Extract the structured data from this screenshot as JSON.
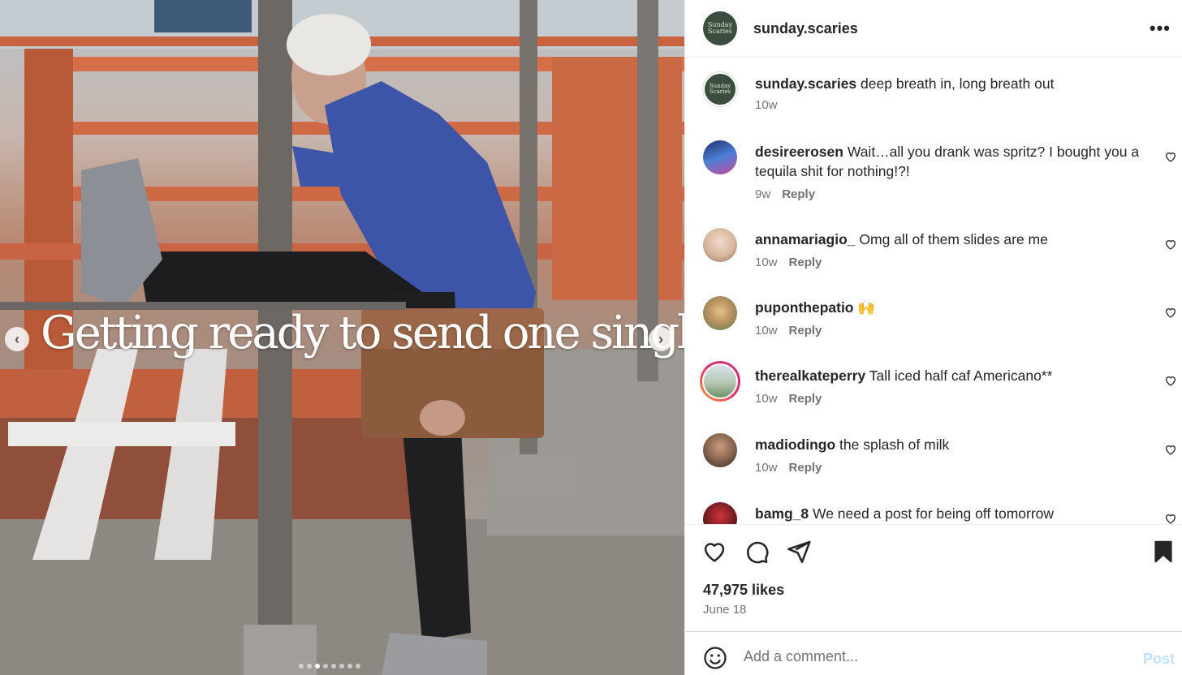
{
  "post": {
    "username": "sunday.scaries",
    "brand_avatar_text": [
      "Sunday",
      "Scaries"
    ],
    "media": {
      "overlay_text": "Getting ready to send one single email",
      "prev_icon": "chevron-left-icon",
      "next_icon": "chevron-right-icon",
      "slide_count": 8,
      "active_slide": 3
    },
    "caption": {
      "username": "sunday.scaries",
      "text": "deep breath in, long breath out",
      "time": "10w"
    },
    "comments": [
      {
        "username": "desireerosen",
        "text": "Wait…all you drank was spritz? I bought you a tequila shit for nothing!?!",
        "time": "9w",
        "reply": "Reply",
        "avatar_color": "#2e4b8f"
      },
      {
        "username": "annamariagio_",
        "text": "Omg all of them slides are me",
        "time": "10w",
        "reply": "Reply",
        "avatar_color": "#d9c2b0"
      },
      {
        "username": "puponthepatio",
        "text": "🙌",
        "time": "10w",
        "reply": "Reply",
        "avatar_color": "#9a8a5e"
      },
      {
        "username": "therealkateperry",
        "text": "Tall iced half caf Americano**",
        "time": "10w",
        "reply": "Reply",
        "avatar_color": "#b6c7b9",
        "story_ring": true
      },
      {
        "username": "madiodingo",
        "text": "the splash of milk",
        "time": "10w",
        "reply": "Reply",
        "avatar_color": "#6d5a4c"
      },
      {
        "username": "bamg_8",
        "text": "We need a post for being off tomorrow",
        "time": "",
        "reply": "",
        "avatar_color": "#7a1f24"
      }
    ],
    "likes": "47,975 likes",
    "date": "June 18",
    "comment_placeholder": "Add a comment...",
    "post_button": "Post",
    "more_icon": "more-horizontal-icon",
    "colors": {
      "brand": "#3a4d3f",
      "post_button": "#c0dffd",
      "meta": "#737373"
    }
  }
}
